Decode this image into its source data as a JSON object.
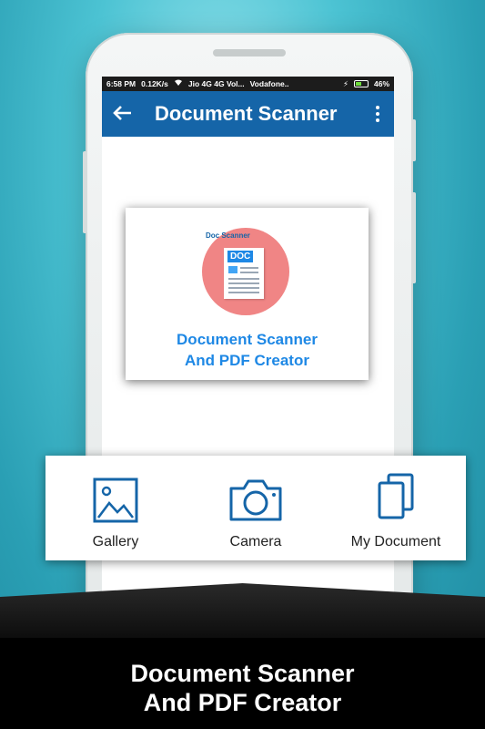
{
  "status_bar": {
    "time": "6:58 PM",
    "speed": "0.12K/s",
    "carrier1": "Jio 4G 4G Vol...",
    "carrier2": "Vodafone..",
    "battery": "46%"
  },
  "app_bar": {
    "title": "Document Scanner",
    "back_icon": "back-arrow-icon",
    "menu_icon": "overflow-menu-icon"
  },
  "logo_card": {
    "badge": "Doc Scanner",
    "doc_tag": "DOC",
    "line1": "Document Scanner",
    "line2": "And PDF Creator"
  },
  "actions": [
    {
      "label": "Gallery",
      "icon": "gallery-icon"
    },
    {
      "label": "Camera",
      "icon": "camera-icon"
    },
    {
      "label": "My Document",
      "icon": "documents-icon"
    }
  ],
  "footer": {
    "line1": "Document Scanner",
    "line2": "And PDF Creator"
  },
  "colors": {
    "app_bar": "#1565a8",
    "accent": "#1e88e5",
    "logo_circle": "#f08585",
    "icon": "#1565a8"
  }
}
